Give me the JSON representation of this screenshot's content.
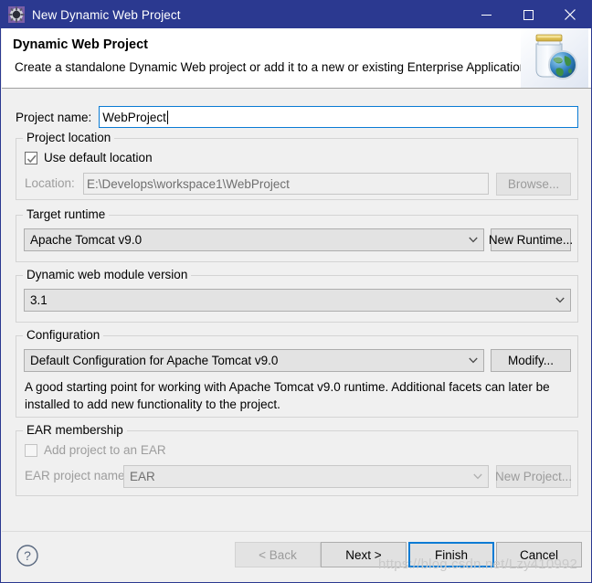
{
  "window": {
    "title": "New Dynamic Web Project",
    "title_icon": "gear-icon",
    "controls": {
      "minimize": "minimize-icon",
      "maximize": "maximize-icon",
      "close": "close-icon"
    },
    "accent_color": "#2b3990",
    "focus_color": "#0a7bd4",
    "body_background": "#f0f0f0"
  },
  "header": {
    "title": "Dynamic Web Project",
    "description": "Create a standalone Dynamic Web project or add it to a new or existing Enterprise Application.",
    "banner_icon": "jar-with-globe-icon"
  },
  "project_name": {
    "label": "Project name:",
    "value": "WebProject",
    "placeholder": ""
  },
  "project_location": {
    "group_title": "Project location",
    "use_default_checkbox": {
      "label": "Use default location",
      "checked": true,
      "enabled": true
    },
    "location_label": "Location:",
    "location_value": "E:\\Develops\\workspace1\\WebProject",
    "browse_button": "Browse..."
  },
  "target_runtime": {
    "group_title": "Target runtime",
    "selected": "Apache Tomcat v9.0",
    "new_runtime_button": "New Runtime..."
  },
  "module_version": {
    "group_title": "Dynamic web module version",
    "selected": "3.1"
  },
  "configuration": {
    "group_title": "Configuration",
    "selected": "Default Configuration for Apache Tomcat v9.0",
    "modify_button": "Modify...",
    "description_line1": "A good starting point for working with Apache Tomcat v9.0 runtime. Additional facets can later be",
    "description_line2": "installed to add new functionality to the project."
  },
  "ear_membership": {
    "group_title": "EAR membership",
    "add_checkbox": {
      "label": "Add project to an EAR",
      "checked": false,
      "enabled": false
    },
    "ear_project_label": "EAR project name:",
    "ear_project_value": "EAR",
    "new_project_button": "New Project..."
  },
  "footer": {
    "help_icon": "help-circle-icon",
    "back_button": "< Back",
    "next_button": "Next >",
    "finish_button": "Finish",
    "cancel_button": "Cancel"
  },
  "watermark": {
    "text": "https://blog.csdn.net/Lzy410992"
  }
}
